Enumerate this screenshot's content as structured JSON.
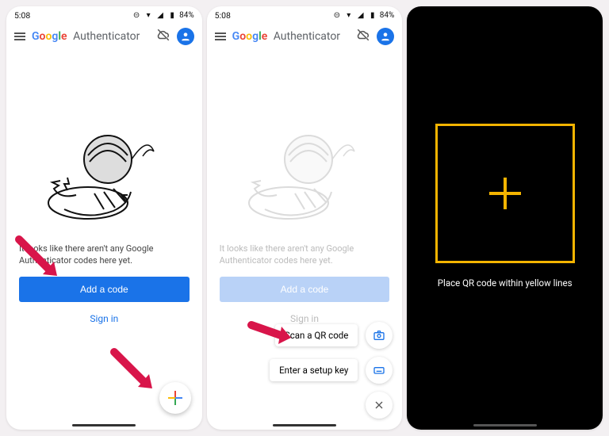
{
  "status": {
    "time": "5:08",
    "battery": "84%"
  },
  "app": {
    "title_brand": "Google",
    "title_app": "Authenticator"
  },
  "screen1": {
    "empty_text": "It looks like there aren't any Google Authenticator codes here yet.",
    "add_button": "Add a code",
    "signin": "Sign in"
  },
  "screen2": {
    "empty_text": "It looks like there aren't any Google Authenticator codes here yet.",
    "add_button": "Add a code",
    "signin": "Sign in",
    "option_scan": "Scan a QR code",
    "option_key": "Enter a setup key"
  },
  "screen3": {
    "instruction": "Place QR code within yellow lines"
  },
  "colors": {
    "primary": "#1a73e8",
    "accent_yellow": "#f4b400"
  }
}
